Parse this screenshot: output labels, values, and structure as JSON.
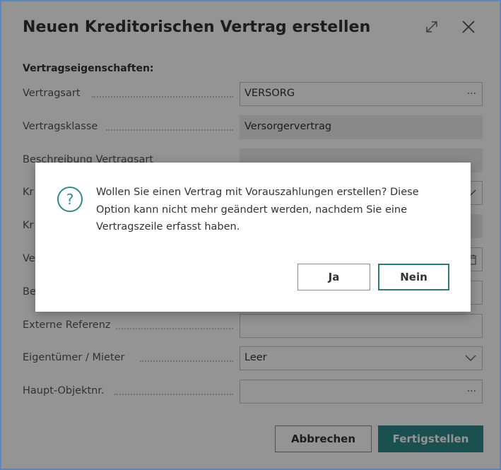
{
  "dialog": {
    "title": "Neuen Kreditorischen Vertrag erstellen",
    "section_label": "Vertragseigenschaften:",
    "fields": [
      {
        "label": "Vertragsart",
        "value": "VERSORG",
        "trail": "···"
      },
      {
        "label": "Vertragsklasse",
        "value": "Versorgervertrag"
      },
      {
        "label": "Beschreibung Vertragsart",
        "value": ""
      },
      {
        "label": "Kr",
        "value": ""
      },
      {
        "label": "Kr",
        "value": ""
      },
      {
        "label": "Ve",
        "value": ""
      },
      {
        "label": "Be",
        "value": ""
      },
      {
        "label": "Externe Referenz",
        "value": ""
      },
      {
        "label": "Eigentümer / Mieter",
        "value": "Leer"
      },
      {
        "label": "Haupt-Objektnr.",
        "value": "",
        "trail": "···"
      }
    ],
    "buttons": {
      "cancel": "Abbrechen",
      "finish": "Fertigstellen"
    }
  },
  "modal": {
    "message": "Wollen Sie einen Vertrag mit Vorauszahlungen erstellen? Diese Option kann nicht mehr geändert werden, nachdem Sie eine Vertragszeile erfasst haben.",
    "yes_label": "Ja",
    "no_label": "Nein"
  },
  "colors": {
    "accent": "#2e8b8b",
    "frame": "#5b86c4"
  }
}
